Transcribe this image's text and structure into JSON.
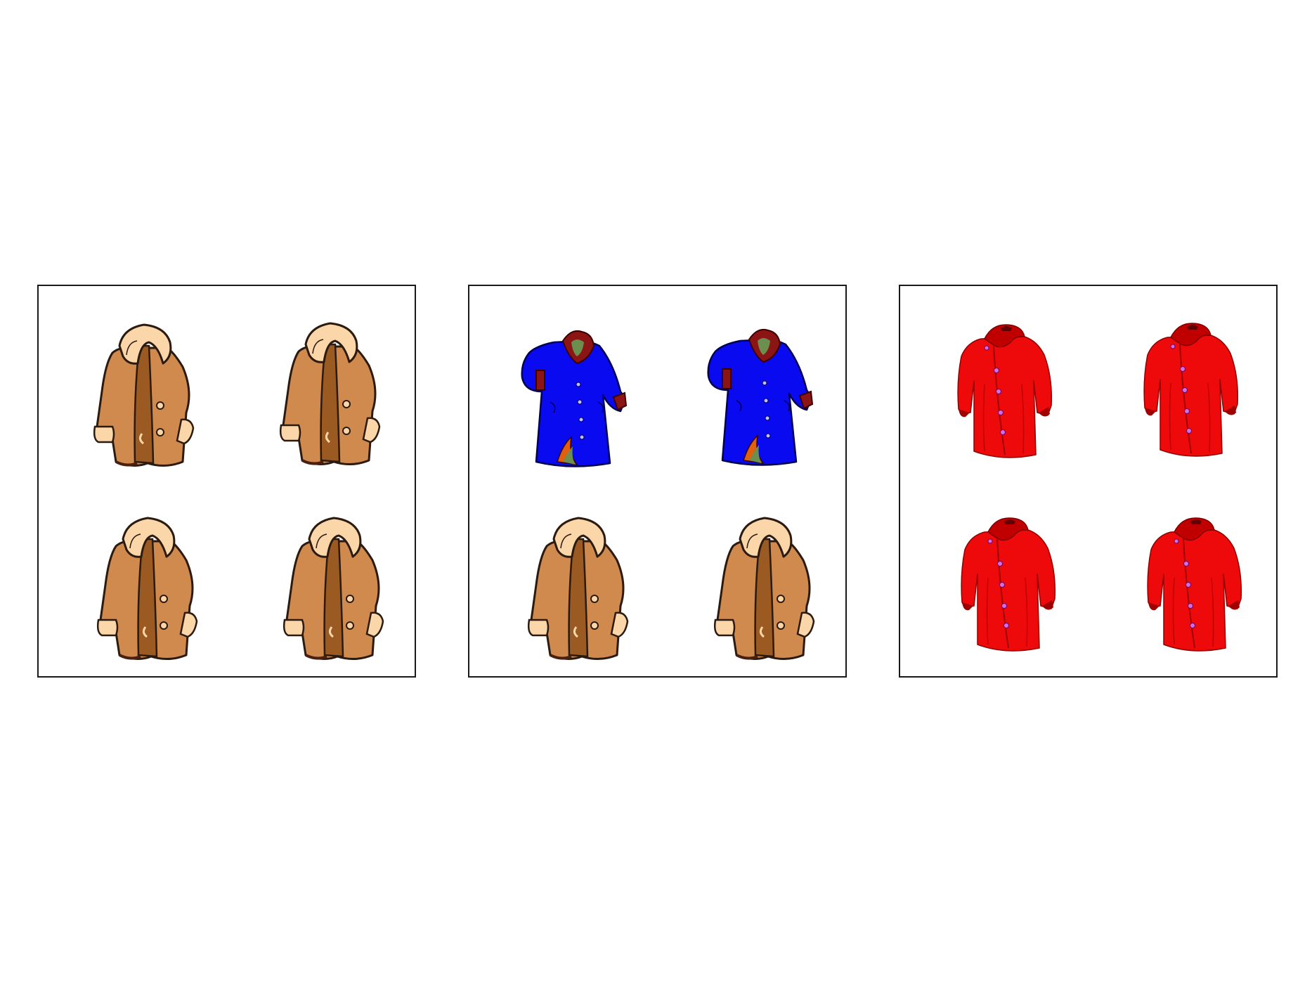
{
  "panels": [
    {
      "name": "panel-left",
      "coats": [
        "brown-fur-coat",
        "brown-fur-coat",
        "brown-fur-coat",
        "brown-fur-coat"
      ]
    },
    {
      "name": "panel-middle",
      "coats": [
        "blue-coat",
        "blue-coat",
        "brown-fur-coat",
        "brown-fur-coat"
      ]
    },
    {
      "name": "panel-right",
      "coats": [
        "red-coat",
        "red-coat",
        "red-coat",
        "red-coat"
      ]
    }
  ],
  "colors": {
    "background": "#ffffff",
    "border": "#1a1a1a",
    "brown_coat": "#d08a4e",
    "brown_fur": "#fad6a8",
    "blue_coat": "#0a0af0",
    "blue_collar": "#8b1414",
    "red_coat": "#ee0a0a",
    "red_shadow": "#b00000"
  }
}
